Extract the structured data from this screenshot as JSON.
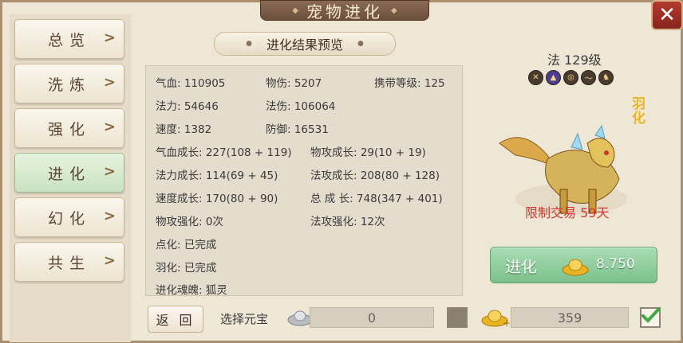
{
  "window": {
    "title": "宠物进化",
    "close": "✕"
  },
  "sidebar": {
    "items": [
      {
        "label": "总览",
        "active": false
      },
      {
        "label": "洗炼",
        "active": false
      },
      {
        "label": "强化",
        "active": false
      },
      {
        "label": "进化",
        "active": true
      },
      {
        "label": "幻化",
        "active": false
      },
      {
        "label": "共生",
        "active": false
      }
    ]
  },
  "result": {
    "header": "进化结果预览",
    "stats": {
      "hp": "气血: 110905",
      "phys_dmg": "物伤: 5207",
      "carry_level": "携带等级: 125",
      "mana": "法力: 54646",
      "magic_dmg": "法伤: 106064",
      "speed": "速度: 1382",
      "defense": "防御: 16531",
      "hp_growth": "气血成长: 227(108 + 119)",
      "phys_atk_growth": "物攻成长: 29(10 + 19)",
      "mana_growth": "法力成长: 114(69 + 45)",
      "magic_atk_growth": "法攻成长: 208(80 + 128)",
      "speed_growth": "速度成长: 170(80 + 90)",
      "total_growth": "总 成 长: 748(347 + 401)",
      "phys_enhance": "物攻强化: 0次",
      "magic_enhance": "法攻强化: 12次",
      "dianhua": "点化: 已完成",
      "yuhua": "羽化: 已完成",
      "soul": "进化魂魄: 狐灵"
    }
  },
  "bottom": {
    "back_label": "返 回",
    "select_label": "选择元宝",
    "ingot_value": "0",
    "gold_value": "359"
  },
  "pet": {
    "level_text": "法 129级",
    "feather_badge": "羽化",
    "trade_limit": "限制交易 59天",
    "skills": [
      "skill-1-icon",
      "skill-2-icon",
      "skill-3-icon",
      "skill-4-icon",
      "skill-5-icon"
    ]
  },
  "evolve": {
    "label": "进化",
    "cost": "8.750"
  },
  "colors": {
    "active_tab": "#c9e2c0",
    "evolve_button": "#7cc08b",
    "trade_limit": "#d8322a",
    "badge": "#e9b322"
  }
}
